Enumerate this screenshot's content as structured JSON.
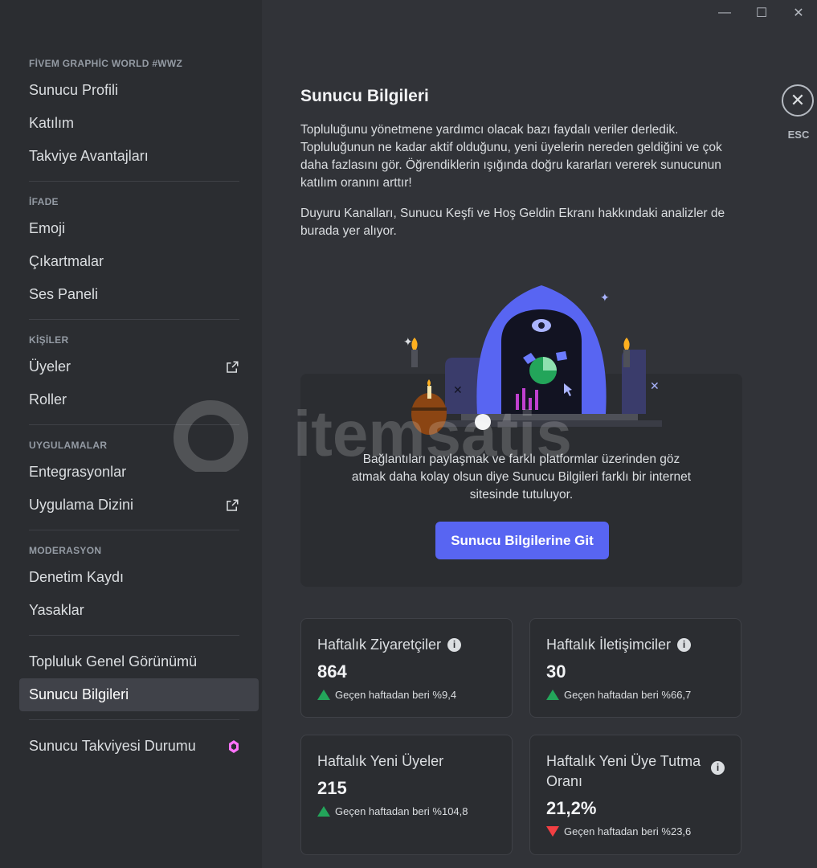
{
  "window_controls": {
    "minimize": "—",
    "maximize": "☐",
    "close": "✕"
  },
  "sidebar": {
    "groups": [
      {
        "header": "FİVEM GRAPHİC WORLD #WWZ",
        "items": [
          {
            "label": "Sunucu Profili"
          },
          {
            "label": "Katılım"
          },
          {
            "label": "Takviye Avantajları"
          }
        ]
      },
      {
        "header": "İFADE",
        "items": [
          {
            "label": "Emoji"
          },
          {
            "label": "Çıkartmalar"
          },
          {
            "label": "Ses Paneli"
          }
        ]
      },
      {
        "header": "KİŞİLER",
        "items": [
          {
            "label": "Üyeler"
          },
          {
            "label": "Roller"
          }
        ]
      },
      {
        "header": "UYGULAMALAR",
        "items": [
          {
            "label": "Entegrasyonlar"
          },
          {
            "label": "Uygulama Dizini"
          }
        ]
      },
      {
        "header": "MODERASYON",
        "items": [
          {
            "label": "Denetim Kaydı"
          },
          {
            "label": "Yasaklar"
          }
        ]
      },
      {
        "header": "",
        "items": [
          {
            "label": "Topluluk Genel Görünümü"
          },
          {
            "label": "Sunucu Bilgileri"
          }
        ]
      },
      {
        "header": "",
        "items": [
          {
            "label": "Sunucu Takviyesi Durumu"
          }
        ]
      }
    ]
  },
  "main": {
    "title": "Sunucu Bilgileri",
    "paragraph1": "Topluluğunu yönetmene yardımcı olacak bazı faydalı veriler derledik. Topluluğunun ne kadar aktif olduğunu, yeni üyelerin nereden geldiğini ve çok daha fazlasını gör. Öğrendiklerin ışığında doğru kararları vererek sunucunun katılım oranını arttır!",
    "paragraph2": "Duyuru Kanalları, Sunucu Keşfi ve Hoş Geldin Ekranı hakkındaki analizler de burada yer alıyor.",
    "panel_text": "Bağlantıları paylaşmak ve farklı platformlar üzerinden göz atmak daha kolay olsun diye Sunucu Bilgileri farklı bir internet sitesinde tutuluyor.",
    "goto_button": "Sunucu Bilgilerine Git",
    "close_label": "ESC",
    "watermark": "itemsatis"
  },
  "stats": [
    {
      "title": "Haftalık Ziyaretçiler",
      "value": "864",
      "trend": "up",
      "change": "Geçen haftadan beri %9,4"
    },
    {
      "title": "Haftalık İletişimciler",
      "value": "30",
      "trend": "up",
      "change": "Geçen haftadan beri %66,7"
    },
    {
      "title": "Haftalık Yeni Üyeler",
      "value": "215",
      "trend": "up",
      "change": "Geçen haftadan beri %104,8"
    },
    {
      "title": "Haftalık Yeni Üye Tutma Oranı",
      "value": "21,2%",
      "trend": "down",
      "change": "Geçen haftadan beri %23,6"
    }
  ],
  "colors": {
    "accent": "#5865f2",
    "up": "#23a55a",
    "down": "#f23f43",
    "boost": "#ff73fa"
  }
}
